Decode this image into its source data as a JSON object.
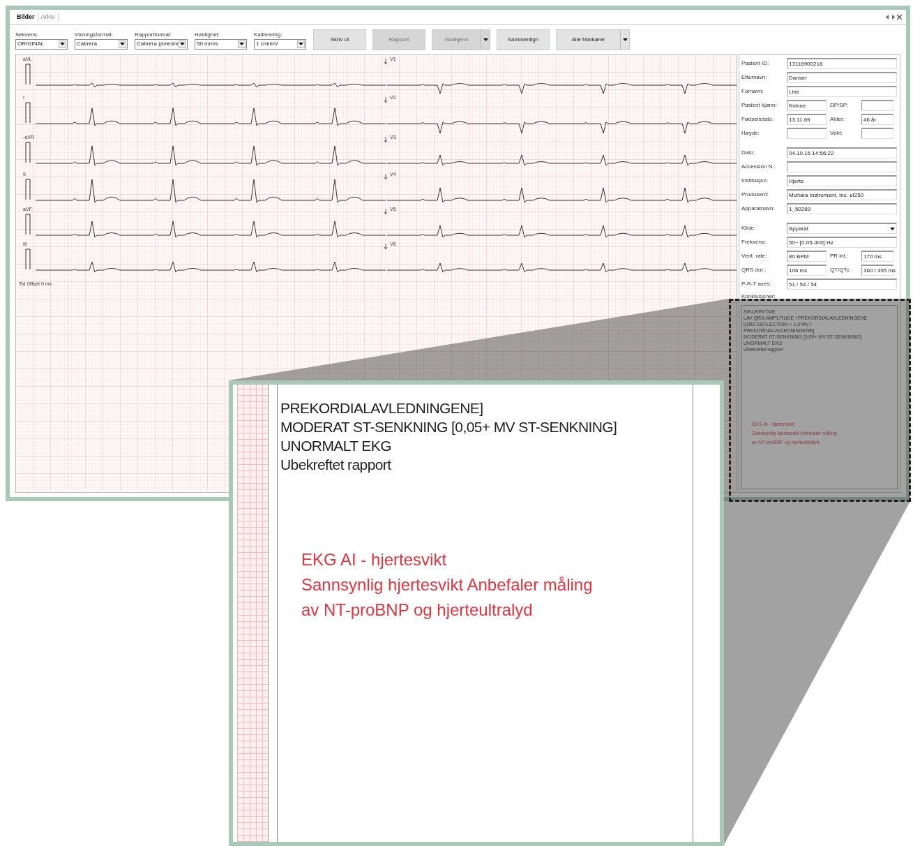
{
  "tabs": [
    {
      "label": "Bilder",
      "selected": true
    },
    {
      "label": "Arkiv",
      "selected": false
    }
  ],
  "toolbar": {
    "dropdowns": [
      {
        "label": "Sekvens:",
        "value": "ORIGINAL"
      },
      {
        "label": "Visningsformat:",
        "value": "Cabrera"
      },
      {
        "label": "Rapportformat:",
        "value": "Cabrera (avledni"
      },
      {
        "label": "Hastighet:",
        "value": "50 mm/s"
      },
      {
        "label": "Kalibrering:",
        "value": "1 cm/mV"
      }
    ],
    "buttons": [
      {
        "label": "Skriv ut",
        "kind": "plain",
        "disabled": false
      },
      {
        "label": "Rapport",
        "kind": "plain",
        "disabled": true
      },
      {
        "label": "Godkjenn",
        "kind": "split",
        "disabled": true
      },
      {
        "label": "Sammenlign",
        "kind": "plain",
        "disabled": false
      },
      {
        "label": "Alle Markører",
        "kind": "split",
        "disabled": false
      }
    ]
  },
  "ecg": {
    "left_leads": [
      "aVL",
      "I",
      "-aVR",
      "II",
      "aVF",
      "III"
    ],
    "right_leads": [
      "V1",
      "V2",
      "V3",
      "V4",
      "V5",
      "V6"
    ],
    "footer": "Tid Offset 0 ms"
  },
  "patient_panel": {
    "groups": [
      [
        {
          "fields": [
            {
              "label": "Pasient ID:",
              "value": "13116900216"
            }
          ]
        },
        {
          "fields": [
            {
              "label": "Etternavn:",
              "value": "Danser"
            }
          ]
        },
        {
          "fields": [
            {
              "label": "Fornavn:",
              "value": "Line"
            }
          ]
        },
        {
          "fields": [
            {
              "label": "Pasient kjønn:",
              "value": "Kvinne"
            },
            {
              "label": "DP/SP:"
            }
          ]
        },
        {
          "fields": [
            {
              "label": "Fødselsdato:",
              "value": "13.11.69"
            },
            {
              "label": "Alder:",
              "value": "46 år"
            }
          ]
        },
        {
          "fields": [
            {
              "label": "Høyde:"
            },
            {
              "label": "Vekt:"
            }
          ]
        }
      ],
      [
        {
          "fields": [
            {
              "label": "Dato:",
              "value": "04.10.16 14:56:22"
            }
          ]
        },
        {
          "fields": [
            {
              "label": "Accession N.:"
            }
          ]
        },
        {
          "fields": [
            {
              "label": "Institusjon:",
              "value": "Hjerte"
            }
          ]
        },
        {
          "fields": [
            {
              "label": "Produsent:",
              "value": "Mortara Instrument, Inc. eI250"
            }
          ]
        },
        {
          "fields": [
            {
              "label": "Apparatnavn:",
              "value": "1_50289"
            }
          ]
        }
      ],
      [
        {
          "kind": "select",
          "fields": [
            {
              "label": "Kilde:",
              "value": "Apparat"
            }
          ]
        },
        {
          "fields": [
            {
              "label": "Frekvens:",
              "value": "50~ [0.05-300] Hz"
            }
          ]
        },
        {
          "fields": [
            {
              "label": "Vent. rate:",
              "value": "80 BPM"
            },
            {
              "label": "PR int.:",
              "value": "170 ms"
            }
          ]
        },
        {
          "fields": [
            {
              "label": "QRS dur.:",
              "value": "106 ms"
            },
            {
              "label": "QT/QTc:",
              "value": "360 / 395 ms"
            }
          ]
        },
        {
          "fields": [
            {
              "label": "P-R-T axes:",
              "value": "51 / 54 / 54"
            }
          ]
        }
      ]
    ],
    "conclusions_label": "Konklusjoner:",
    "conclusions": [
      {
        "text": "SINUSRYTME",
        "kind": "finding"
      },
      {
        "text": "LAV QRS-AMPLITUDE I PREKORDIALAVLEDNINGENE",
        "kind": "finding"
      },
      {
        "text": "[QRS DEFLECTION < 1,0 MV I",
        "kind": "finding"
      },
      {
        "text": "PREKORDIALAVLEDNINGENE]",
        "kind": "finding"
      },
      {
        "text": "MODERAT ST-SENKNING [0,05+ MV ST-SENKNING]",
        "kind": "finding"
      },
      {
        "text": "UNORMALT EKG",
        "kind": "finding"
      },
      {
        "text": "Ubekreftet rapport",
        "kind": "finding"
      },
      {
        "text": "EKG AI - hjertesvikt",
        "kind": "ai"
      },
      {
        "text": "Sannsynlig hjertesvikt Anbefaler måling",
        "kind": "ai"
      },
      {
        "text": "av NT-proBNP og hjerteultralyd",
        "kind": "ai"
      }
    ]
  },
  "magnified": {
    "lines": [
      {
        "text": "PREKORDIALAVLEDNINGENE]",
        "kind": "finding"
      },
      {
        "text": "MODERAT ST-SENKNING [0,05+ MV ST-SENKNING]",
        "kind": "finding"
      },
      {
        "text": "UNORMALT EKG",
        "kind": "finding"
      },
      {
        "text": "Ubekreftet rapport",
        "kind": "finding"
      },
      {
        "text": "EKG AI - hjertesvikt",
        "kind": "ai"
      },
      {
        "text": "Sannsynlig hjertesvikt Anbefaler måling",
        "kind": "ai"
      },
      {
        "text": "av NT-proBNP og hjerteultralyd",
        "kind": "ai"
      }
    ]
  }
}
